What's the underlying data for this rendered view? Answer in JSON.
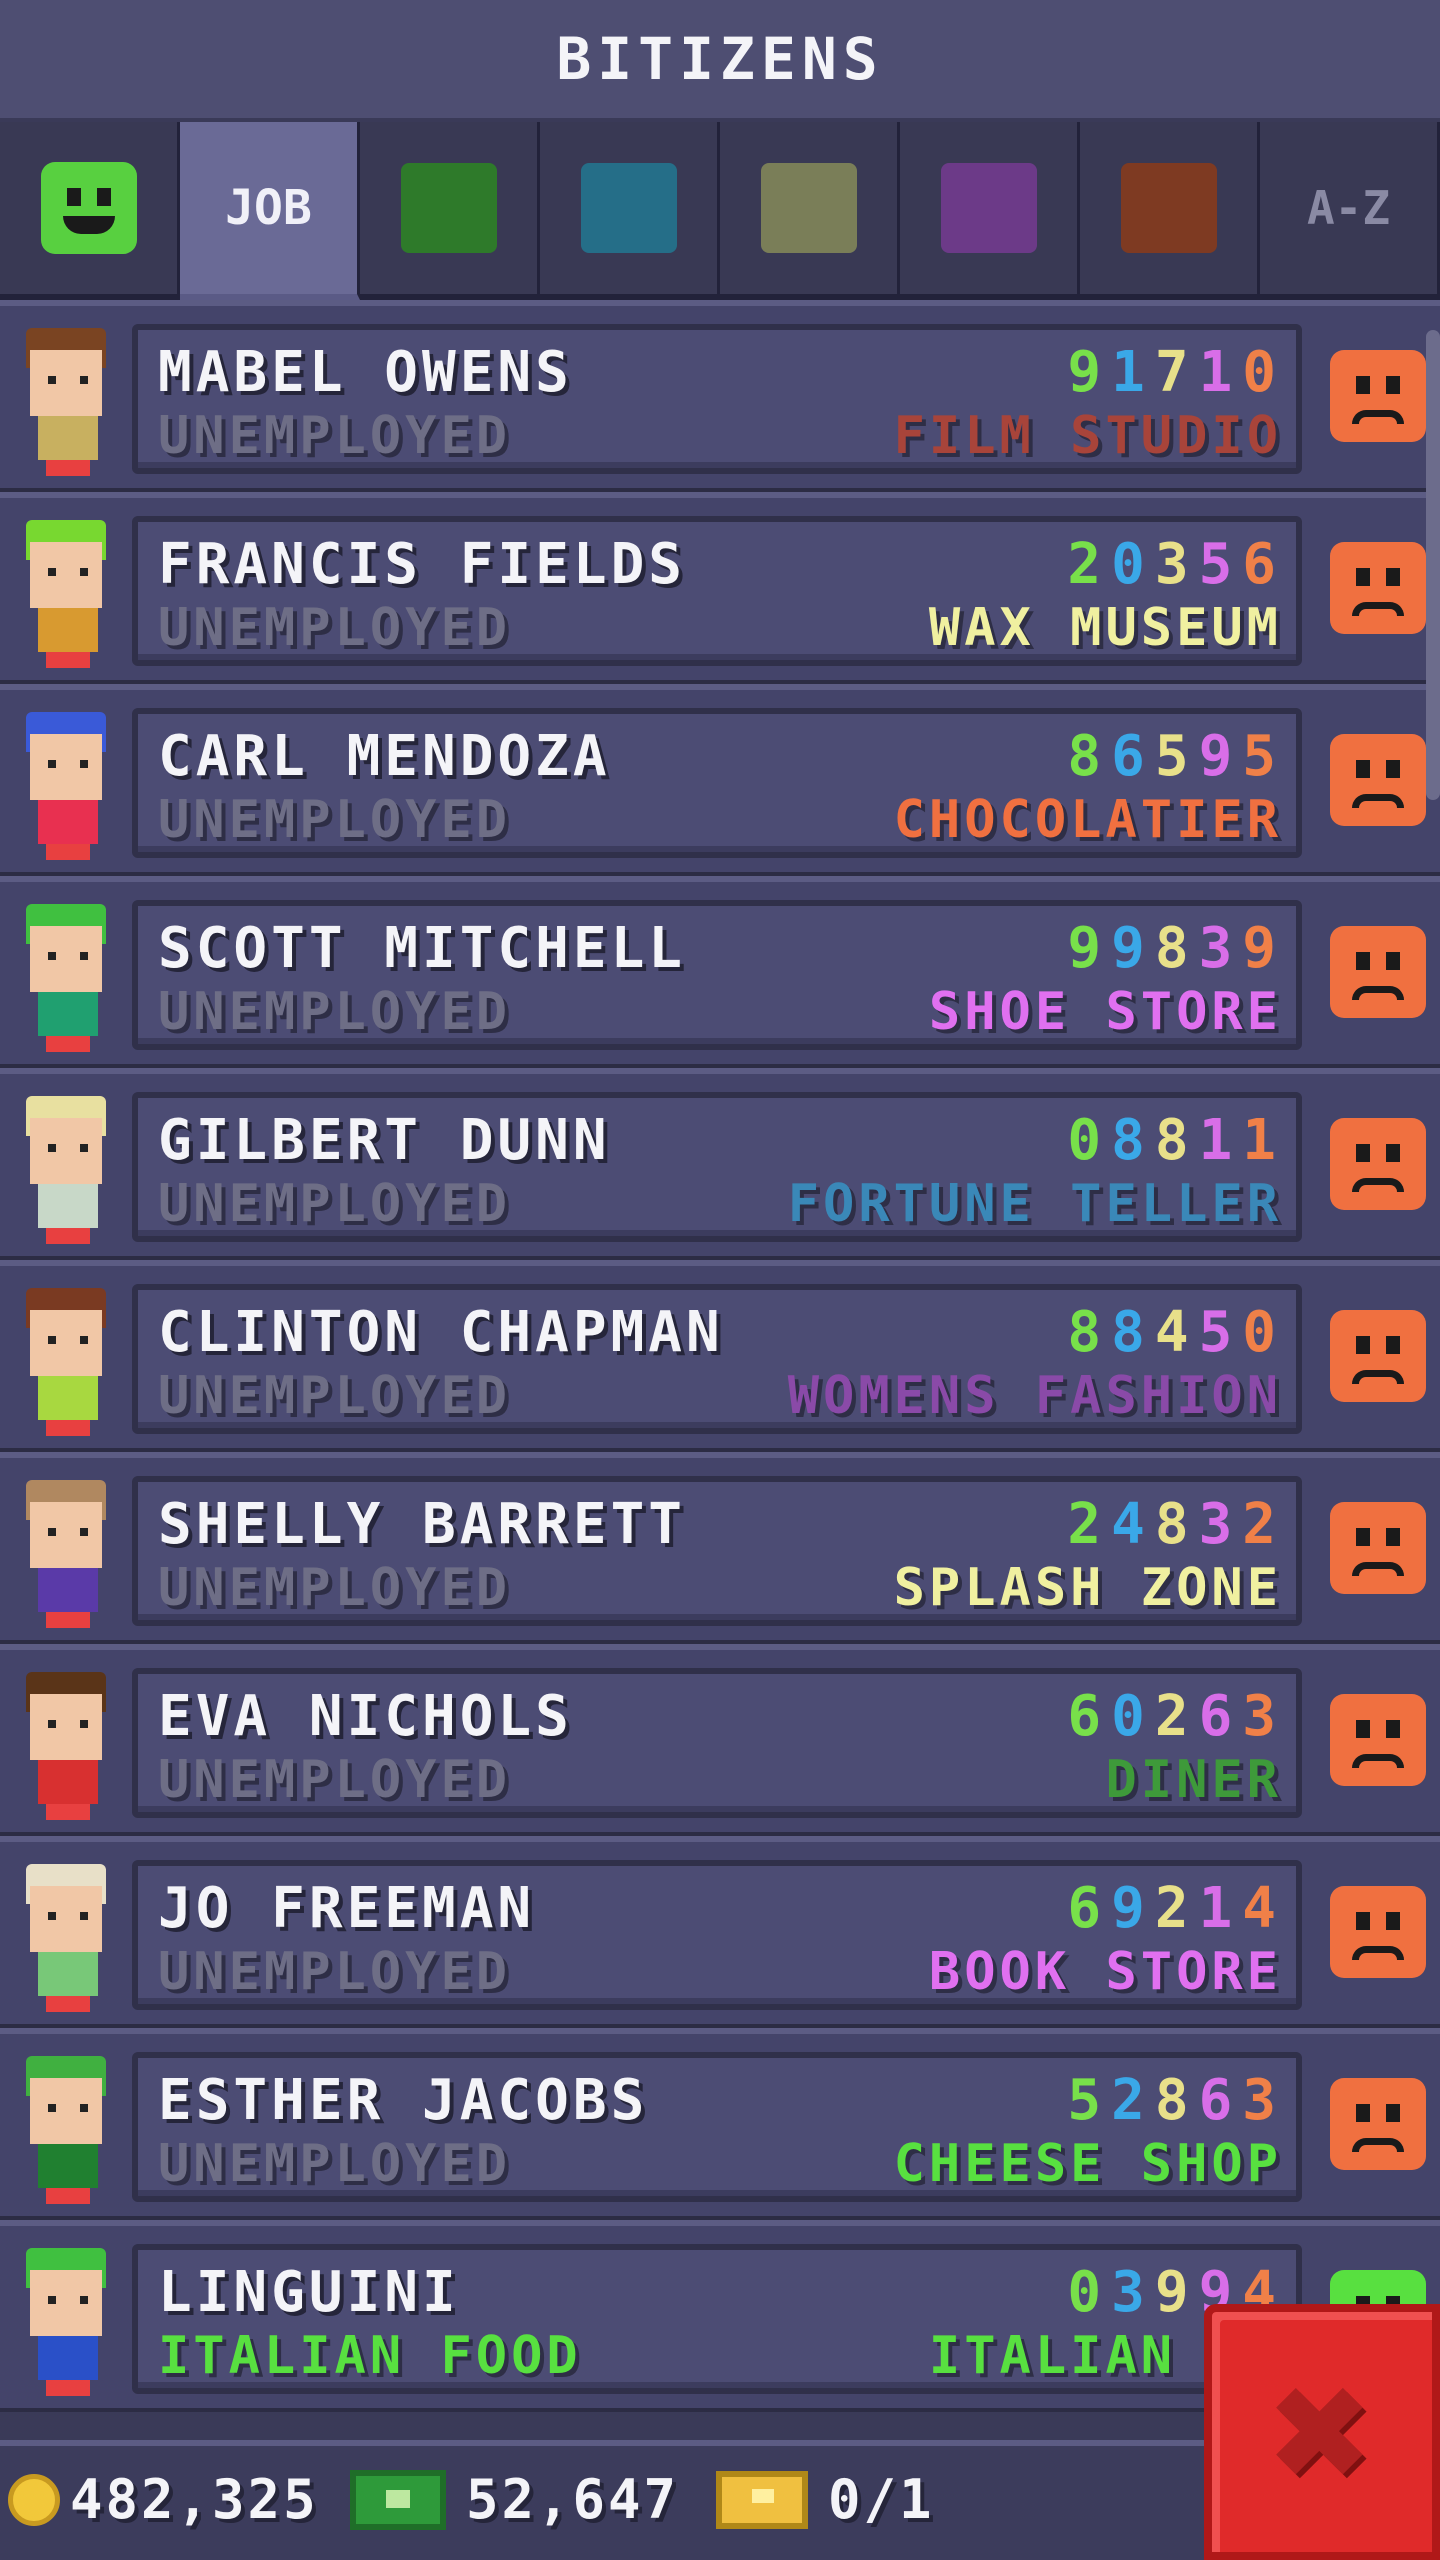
{
  "app": {
    "title": "BITIZENS"
  },
  "tabs": [
    {
      "kind": "mood",
      "icon": "happy-face-icon",
      "color": "#3a8a2a"
    },
    {
      "kind": "text",
      "label": "JOB",
      "active": true
    },
    {
      "kind": "color",
      "icon": "green-category",
      "color": "#2e7a2a"
    },
    {
      "kind": "color",
      "icon": "teal-category",
      "color": "#256e88"
    },
    {
      "kind": "color",
      "icon": "olive-category",
      "color": "#7a7e58"
    },
    {
      "kind": "color",
      "icon": "purple-category",
      "color": "#6c3a88"
    },
    {
      "kind": "color",
      "icon": "rust-category",
      "color": "#7e3a22"
    },
    {
      "kind": "text",
      "label": "A-Z"
    }
  ],
  "digit_colors": [
    "#78e04a",
    "#3aa8e8",
    "#e8e08a",
    "#d86ee8",
    "#f08048"
  ],
  "rows": [
    {
      "name": "MABEL OWENS",
      "job": "UNEMPLOYED",
      "number": "91710",
      "dream": "FILM STUDIO",
      "dream_color": "#a8443a",
      "mood": "sad",
      "hair": "#7a4422",
      "shirt": "#c8b060"
    },
    {
      "name": "FRANCIS FIELDS",
      "job": "UNEMPLOYED",
      "number": "20356",
      "dream": "WAX MUSEUM",
      "dream_color": "#f0f0a0",
      "mood": "sad",
      "hair": "#78d830",
      "shirt": "#d89a30"
    },
    {
      "name": "CARL MENDOZA",
      "job": "UNEMPLOYED",
      "number": "86595",
      "dream": "CHOCOLATIER",
      "dream_color": "#f07040",
      "mood": "sad",
      "hair": "#3a5ad8",
      "shirt": "#e83050"
    },
    {
      "name": "SCOTT MITCHELL",
      "job": "UNEMPLOYED",
      "number": "99839",
      "dream": "SHOE STORE",
      "dream_color": "#e070f0",
      "mood": "sad",
      "hair": "#40c040",
      "shirt": "#20a070"
    },
    {
      "name": "GILBERT DUNN",
      "job": "UNEMPLOYED",
      "number": "08811",
      "dream": "FORTUNE TELLER",
      "dream_color": "#3a88b8",
      "mood": "sad",
      "hair": "#e8e0a0",
      "shirt": "#c8d8c8"
    },
    {
      "name": "CLINTON CHAPMAN",
      "job": "UNEMPLOYED",
      "number": "88450",
      "dream": "WOMENS FASHION",
      "dream_color": "#8a4aa8",
      "mood": "sad",
      "hair": "#7a3a22",
      "shirt": "#a8d840"
    },
    {
      "name": "SHELLY BARRETT",
      "job": "UNEMPLOYED",
      "number": "24832",
      "dream": "SPLASH ZONE",
      "dream_color": "#f0f0a0",
      "mood": "sad",
      "hair": "#b08860",
      "shirt": "#5a3aa8"
    },
    {
      "name": "EVA NICHOLS",
      "job": "UNEMPLOYED",
      "number": "60263",
      "dream": "DINER",
      "dream_color": "#3e9a3a",
      "mood": "sad",
      "hair": "#5a3418",
      "shirt": "#d83030"
    },
    {
      "name": "JO FREEMAN",
      "job": "UNEMPLOYED",
      "number": "69214",
      "dream": "BOOK STORE",
      "dream_color": "#e070f0",
      "mood": "sad",
      "hair": "#e8e0c8",
      "shirt": "#78c878"
    },
    {
      "name": "ESTHER JACOBS",
      "job": "UNEMPLOYED",
      "number": "52863",
      "dream": "CHEESE SHOP",
      "dream_color": "#58e040",
      "mood": "sad",
      "hair": "#40b040",
      "shirt": "#208030"
    },
    {
      "name": "LINGUINI",
      "job": "ITALIAN FOOD",
      "job_color": "#58e040",
      "number": "03994",
      "dream": "ITALIAN FO",
      "dream_color": "#58e040",
      "mood": "happy",
      "hair": "#40c040",
      "shirt": "#2a50c8"
    }
  ],
  "footer": {
    "coins": "482,325",
    "bux": "52,647",
    "tickets": "0/1"
  },
  "colors": {
    "sad_face": "#f07040",
    "happy_face": "#58e040"
  }
}
